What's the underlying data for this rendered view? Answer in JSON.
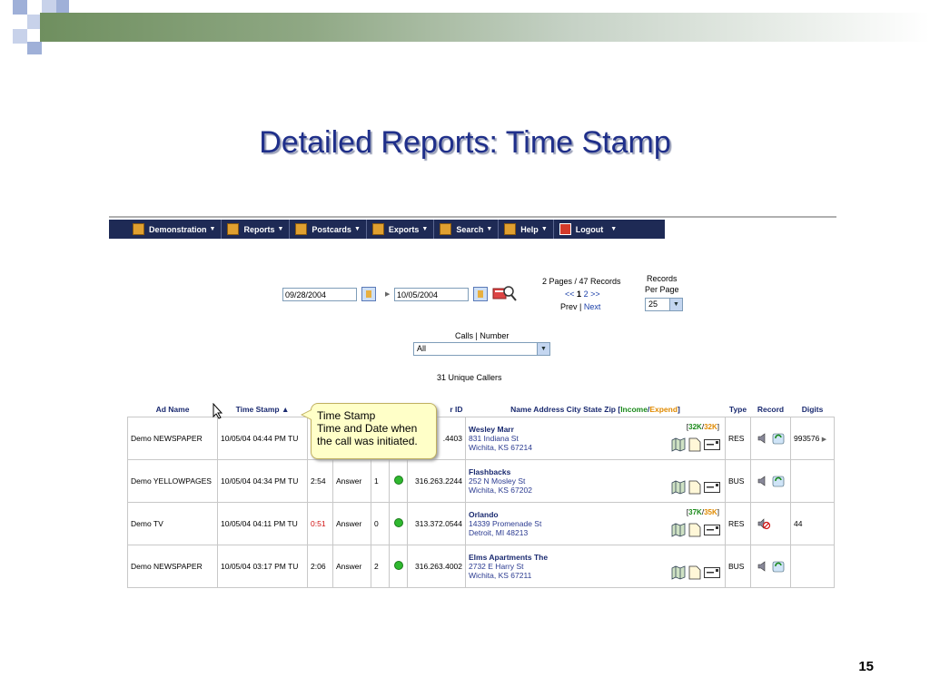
{
  "slide": {
    "title": "Detailed Reports:  Time Stamp",
    "number": "15",
    "colors": {
      "title": "#1f2f8a",
      "band": "#8fa884",
      "square_dark": "#9fb0d8",
      "square_light": "#c8d2ea"
    }
  },
  "menu": {
    "items": [
      {
        "label": "Demonstration",
        "icon": "demonstration-icon"
      },
      {
        "label": "Reports",
        "icon": "reports-icon"
      },
      {
        "label": "Postcards",
        "icon": "postcards-icon"
      },
      {
        "label": "Exports",
        "icon": "exports-icon"
      },
      {
        "label": "Search",
        "icon": "search-icon"
      },
      {
        "label": "Help",
        "icon": "help-icon"
      },
      {
        "label": "Logout",
        "icon": "logout-icon"
      }
    ],
    "bg_color": "#1e2a55"
  },
  "filters": {
    "start_date": "09/28/2004",
    "end_date": "10/05/2004",
    "pages_info": "2 Pages / 47 Records",
    "pager_first": "<<",
    "pager_current": "1",
    "pager_next_page": "2",
    "pager_last": ">>",
    "prev_label": "Prev",
    "separator": "|",
    "next_label": "Next",
    "records_label_1": "Records",
    "records_label_2": "Per Page",
    "records_per_page": "25",
    "calls_label": "Calls | Number",
    "calls_value": "All",
    "unique_callers": "31 Unique Callers"
  },
  "table": {
    "headers": {
      "ad_name": "Ad Name",
      "time_stamp": "Time Stamp",
      "caller_id": "r ID",
      "name_address_prefix": "Name Address City State Zip [",
      "income": "Income",
      "slash": "/",
      "expend": "Expend",
      "close_bracket": "]",
      "type": "Type",
      "record": "Record",
      "digits": "Digits"
    },
    "rows": [
      {
        "ad_name": "Demo NEWSPAPER",
        "time_stamp": "10/05/04 04:44 PM TU",
        "duration": "",
        "status": "",
        "count": "",
        "caller_id": ".4403",
        "name": "Wesley Marr",
        "street": "831 Indiana St",
        "city": "Wichita, KS 67214",
        "income": "32K",
        "expend": "32K",
        "type": "RES",
        "digits": "993576"
      },
      {
        "ad_name": "Demo YELLOWPAGES",
        "time_stamp": "10/05/04 04:34 PM TU",
        "duration": "2:54",
        "status": "Answer",
        "count": "1",
        "caller_id": "316.263.2244",
        "name": "Flashbacks",
        "street": "252 N Mosley St",
        "city": "Wichita, KS 67202",
        "income": "",
        "expend": "",
        "type": "BUS",
        "digits": ""
      },
      {
        "ad_name": "Demo TV",
        "time_stamp": "10/05/04 04:11 PM TU",
        "duration": "0:51",
        "status": "Answer",
        "count": "0",
        "caller_id": "313.372.0544",
        "name": "Orlando",
        "street": "14339 Promenade St",
        "city": "Detroit, MI 48213",
        "income": "37K",
        "expend": "35K",
        "type": "RES",
        "digits": "44"
      },
      {
        "ad_name": "Demo NEWSPAPER",
        "time_stamp": "10/05/04 03:17 PM TU",
        "duration": "2:06",
        "status": "Answer",
        "count": "2",
        "caller_id": "316.263.4002",
        "name": "Elms Apartments The",
        "street": "2732 E Harry St",
        "city": "Wichita, KS 67211",
        "income": "",
        "expend": "",
        "type": "BUS",
        "digits": ""
      }
    ]
  },
  "tooltip": {
    "title": "Time Stamp",
    "line1": "Time and Date when",
    "line2": "the call was initiated."
  }
}
